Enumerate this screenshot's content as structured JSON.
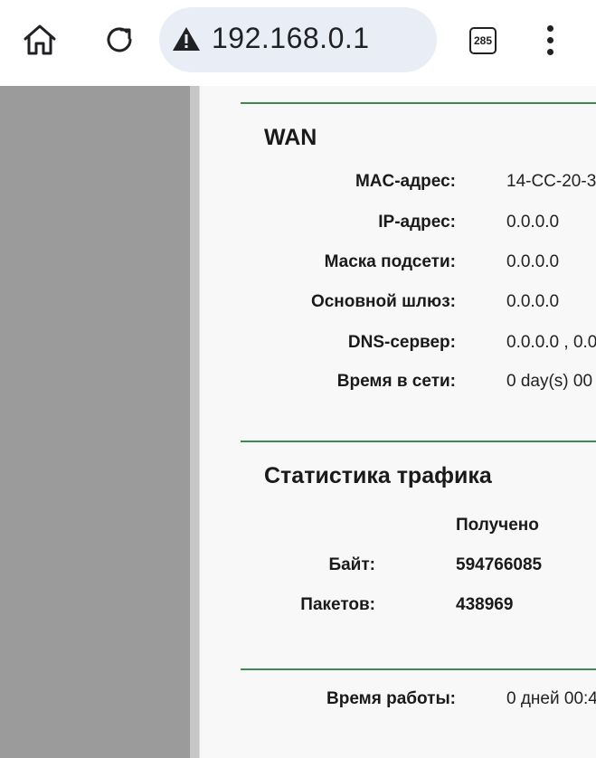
{
  "browser": {
    "url": "192.168.0.1",
    "tab_count": "285",
    "icons": [
      "home-icon",
      "reload-icon",
      "warning-icon",
      "tab-switcher-icon",
      "more-vert-icon"
    ]
  },
  "wan": {
    "title": "WAN",
    "rows": [
      {
        "label": "MAC-адрес:",
        "value": "14-CC-20-3"
      },
      {
        "label": "IP-адрес:",
        "value": "0.0.0.0"
      },
      {
        "label": "Маска подсети:",
        "value": "0.0.0.0"
      },
      {
        "label": "Основной шлюз:",
        "value": "0.0.0.0"
      },
      {
        "label": "DNS-сервер:",
        "value": "0.0.0.0 , 0.0"
      },
      {
        "label": "Время в сети:",
        "value": "0 day(s) 00"
      }
    ]
  },
  "traffic": {
    "title": "Статистика трафика",
    "received_header": "Получено",
    "rows": [
      {
        "label": "Байт:",
        "value": "594766085"
      },
      {
        "label": "Пакетов:",
        "value": "438969"
      }
    ]
  },
  "uptime": {
    "label": "Время работы:",
    "value": "0 дней 00:4"
  },
  "colors": {
    "divider": "#3f8a4f",
    "left_frame": "#9b9b9b",
    "url_bar": "#e9eef6"
  }
}
